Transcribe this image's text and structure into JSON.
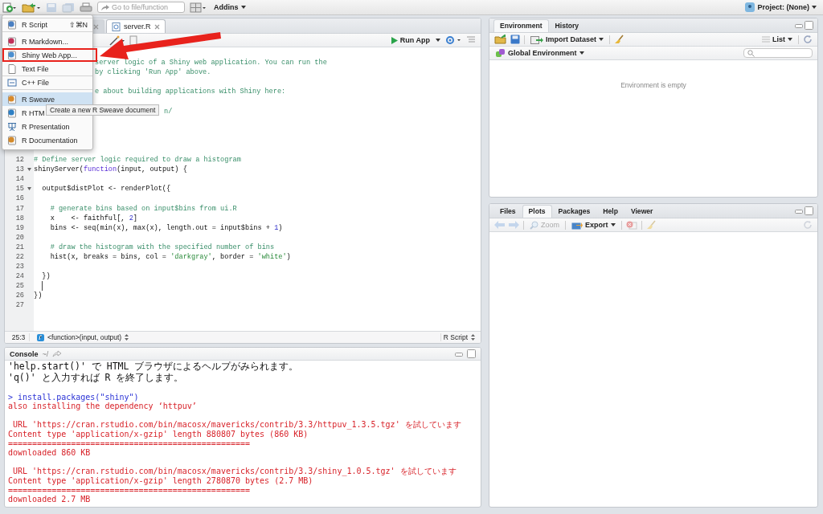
{
  "toolbar": {
    "goto_placeholder": "Go to file/function",
    "addins": "Addins",
    "project": "Project: (None)"
  },
  "new_file_menu": {
    "items": [
      {
        "label": "R Script",
        "kind": "rscript",
        "shortcut": "⇧⌘N",
        "hovered": false,
        "highlighted": false,
        "divider_after": true
      },
      {
        "label": "R Markdown...",
        "kind": "rmd",
        "hovered": false,
        "highlighted": false,
        "divider_after": false
      },
      {
        "label": "Shiny Web App...",
        "kind": "shiny",
        "hovered": false,
        "highlighted": true,
        "divider_after": false
      },
      {
        "label": "Text File",
        "kind": "text",
        "hovered": false,
        "highlighted": false,
        "divider_after": false
      },
      {
        "label": "C++ File",
        "kind": "cpp",
        "hovered": false,
        "highlighted": false,
        "divider_after": true
      },
      {
        "label": "R Sweave",
        "kind": "sweave",
        "hovered": true,
        "highlighted": false,
        "divider_after": false
      },
      {
        "label": "R HTM",
        "kind": "html",
        "hovered": false,
        "highlighted": false,
        "divider_after": false
      },
      {
        "label": "R Presentation",
        "kind": "presentation",
        "hovered": false,
        "highlighted": false,
        "divider_after": false
      },
      {
        "label": "R Documentation",
        "kind": "doc",
        "hovered": false,
        "highlighted": false,
        "divider_after": false
      }
    ],
    "tooltip": "Create a new R Sweave document"
  },
  "editor": {
    "tabs": [
      {
        "selected": false
      },
      {
        "label": "server.R",
        "selected": true
      }
    ],
    "run_app": "Run App",
    "lines": [
      {
        "kind": "hidden"
      },
      {
        "kind": "partial",
        "segs": [
          {
            "kind": "comment",
            "t": "server logic of a Shiny web application. You can run the"
          }
        ]
      },
      {
        "kind": "partial",
        "segs": [
          {
            "kind": "comment",
            "t": "by clicking 'Run App' above."
          }
        ]
      },
      {
        "kind": "hidden"
      },
      {
        "kind": "partial",
        "segs": [
          {
            "kind": "comment",
            "t": "e about building applications with Shiny here:"
          }
        ]
      },
      {
        "kind": "hidden"
      },
      {
        "kind": "far",
        "segs": [
          {
            "kind": "comment",
            "t": "n/"
          }
        ]
      },
      {
        "kind": "hidden"
      },
      {
        "kind": "hidden"
      },
      {
        "kind": "hidden"
      },
      {
        "kind": "hidden"
      },
      {
        "kind": "full",
        "n": "12",
        "segs": [
          {
            "kind": "comment",
            "t": "# Define server logic required to draw a histogram"
          }
        ]
      },
      {
        "kind": "full",
        "n": "13",
        "fold": true,
        "segs": [
          {
            "kind": "plain",
            "t": "shinyServer("
          },
          {
            "kind": "keyword",
            "t": "function"
          },
          {
            "kind": "plain",
            "t": "(input, output) {"
          }
        ]
      },
      {
        "kind": "full",
        "n": "14"
      },
      {
        "kind": "full",
        "n": "15",
        "fold": true,
        "segs": [
          {
            "kind": "plain",
            "t": "  output$distPlot <- renderPlot({"
          }
        ]
      },
      {
        "kind": "full",
        "n": "16"
      },
      {
        "kind": "full",
        "n": "17",
        "segs": [
          {
            "kind": "comment",
            "t": "    # generate bins based on input$bins from ui.R"
          }
        ]
      },
      {
        "kind": "full",
        "n": "18",
        "segs": [
          {
            "kind": "plain",
            "t": "    x    <- faithful[, "
          },
          {
            "kind": "number",
            "t": "2"
          },
          {
            "kind": "plain",
            "t": "]"
          }
        ]
      },
      {
        "kind": "full",
        "n": "19",
        "segs": [
          {
            "kind": "plain",
            "t": "    bins <- seq(min(x), max(x), length.out = input$bins + "
          },
          {
            "kind": "number",
            "t": "1"
          },
          {
            "kind": "plain",
            "t": ")"
          }
        ]
      },
      {
        "kind": "full",
        "n": "20"
      },
      {
        "kind": "full",
        "n": "21",
        "segs": [
          {
            "kind": "comment",
            "t": "    # draw the histogram with the specified number of bins"
          }
        ]
      },
      {
        "kind": "full",
        "n": "22",
        "segs": [
          {
            "kind": "plain",
            "t": "    hist(x, breaks = bins, col = "
          },
          {
            "kind": "string",
            "t": "'darkgray'"
          },
          {
            "kind": "plain",
            "t": ", border = "
          },
          {
            "kind": "string",
            "t": "'white'"
          },
          {
            "kind": "plain",
            "t": ")"
          }
        ]
      },
      {
        "kind": "full",
        "n": "23"
      },
      {
        "kind": "full",
        "n": "24",
        "segs": [
          {
            "kind": "plain",
            "t": "  })"
          }
        ]
      },
      {
        "kind": "full",
        "n": "25",
        "cursor": true
      },
      {
        "kind": "full",
        "n": "26",
        "segs": [
          {
            "kind": "plain",
            "t": "})"
          }
        ]
      },
      {
        "kind": "full",
        "n": "27"
      }
    ],
    "status": {
      "position": "25:3",
      "scope": "<function>(input, output)",
      "file_type": "R Script"
    }
  },
  "environment_pane": {
    "tabs": [
      {
        "label": "Environment",
        "selected": true
      },
      {
        "label": "History",
        "selected": false
      }
    ],
    "import": "Import Dataset",
    "view": "List",
    "scope": "Global Environment",
    "empty_message": "Environment is empty"
  },
  "files_pane": {
    "tabs": [
      {
        "label": "Files",
        "selected": false
      },
      {
        "label": "Plots",
        "selected": true
      },
      {
        "label": "Packages",
        "selected": false
      },
      {
        "label": "Help",
        "selected": false
      },
      {
        "label": "Viewer",
        "selected": false
      }
    ],
    "zoom": {
      "label": "Zoom",
      "disabled": true
    },
    "export": {
      "label": "Export",
      "disabled": false
    }
  },
  "console": {
    "title": "Console",
    "path": "~/",
    "lines": [
      {
        "kind": "message",
        "text": "'help.start()' で HTML ブラウザによるヘルプがみられます。"
      },
      {
        "kind": "message",
        "text": "'q()' と入力すれば R を終了します。"
      },
      {
        "kind": "blank"
      },
      {
        "kind": "input",
        "text": "> install.packages(\"shiny\")"
      },
      {
        "kind": "output",
        "text": "also installing the dependency ‘httpuv’"
      },
      {
        "kind": "blank"
      },
      {
        "kind": "output",
        "text": " URL 'https://cran.rstudio.com/bin/macosx/mavericks/contrib/3.3/httpuv_1.3.5.tgz' を試しています"
      },
      {
        "kind": "output",
        "text": "Content type 'application/x-gzip' length 880807 bytes (860 KB)"
      },
      {
        "kind": "output",
        "text": "=================================================="
      },
      {
        "kind": "output",
        "text": "downloaded 860 KB"
      },
      {
        "kind": "blank"
      },
      {
        "kind": "output",
        "text": " URL 'https://cran.rstudio.com/bin/macosx/mavericks/contrib/3.3/shiny_1.0.5.tgz' を試しています"
      },
      {
        "kind": "output",
        "text": "Content type 'application/x-gzip' length 2780870 bytes (2.7 MB)"
      },
      {
        "kind": "output",
        "text": "=================================================="
      },
      {
        "kind": "output",
        "text": "downloaded 2.7 MB"
      }
    ]
  }
}
